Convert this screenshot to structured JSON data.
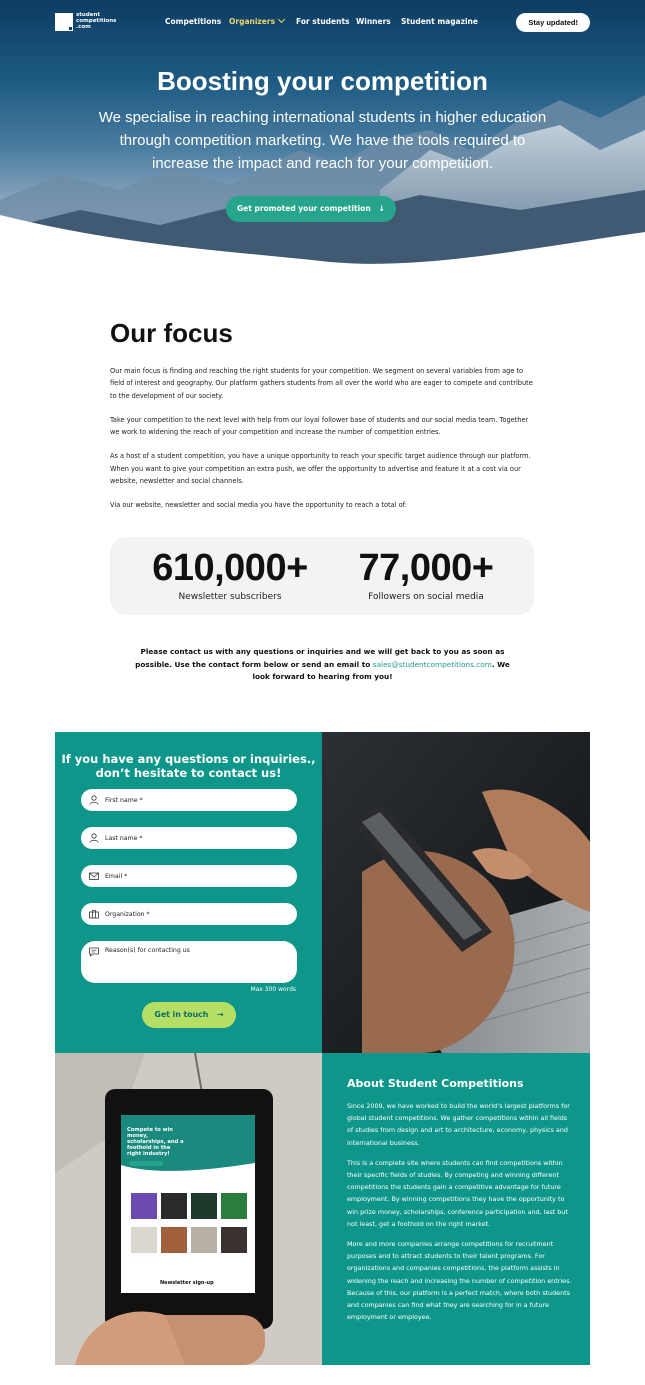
{
  "nav": {
    "logo_text": "student\ncompetitions\n.com",
    "items": [
      "Competitions",
      "Organizers",
      "For students",
      "Winners",
      "Student magazine"
    ],
    "cta": "Stay updated!"
  },
  "hero": {
    "title": "Boosting your competition",
    "subtitle": "We specialise in reaching international students in higher education through competition marketing. We have the tools required to increase the impact and reach for your competition.",
    "button": "Get promoted your competition",
    "button_arrow": "↓"
  },
  "focus": {
    "title": "Our focus",
    "paragraphs": [
      "Our main focus is finding and reaching the right students for your competition. We segment on several variables from age to field of interest and geography. Our platform gathers students from all over the world who are eager to compete and contribute to the development of our society.",
      "Take your competition to the next level with help from our loyal follower base of students and our social media team. Together we work to widening the reach of your competition and increase the number of competition entries.",
      "As a host of a student competition, you have a unique opportunity to reach your specific target audience through our platform. When you want to give your competition an extra push, we offer the opportunity to advertise and feature it at a cost via our website, newsletter and social channels.",
      "Via our website, newsletter and social media you have the opportunity to reach a total of:"
    ]
  },
  "stats": [
    {
      "value": "610,000+",
      "label": "Newsletter subscribers"
    },
    {
      "value": "77,000+",
      "label": "Followers on social media"
    }
  ],
  "contact_note": {
    "before": "Please contact us with any questions or inquiries and we will get back to you as soon as possible. Use the contact form below or send an email to ",
    "email": "sales@studentcompetitions.com",
    "after": ". We look forward to hearing from you!"
  },
  "form": {
    "title": "If you have any questions or inquiries., don’t hesitate to contact us!",
    "fields": [
      "First name *",
      "Last name *",
      "Email *",
      "Organization *",
      "Reason(s) for contacting us"
    ],
    "max_words": "Max 300 words",
    "button": "Get in touch",
    "button_arrow": "→"
  },
  "about": {
    "title": "About Student Competitions",
    "paragraphs": [
      "Since 2009, we have worked to build the world’s largest platforms for global student competitions. We gather competitions within all fields of studies from design and art to architecture, economy, physics and international business.",
      "This is a complete site where students can find competitions within their specific fields of studies. By competing and winning different competitions the students gain a competitive advantage for future employment. By winning competitions they have the opportunity to win prize money, scholarships, conference participation and, last but not least, get a foothold on the right market.",
      "More and more companies arrange competitions for recruitment purposes and to attract students to their talent programs. For organizations and companies competitions, the platform assists in widening the reach and increasing the number of competition entries. Because of this, our platform is a perfect match, where both students and companies can find what they are searching for in a future employment or employee."
    ]
  },
  "tablet_screen": {
    "hero_text": "Compete to win money, scholarships, and a foothold in the right industry!",
    "newsletter": "Newsletter sign-up"
  },
  "colors": {
    "teal": "#0f968a",
    "green_button": "#26a58c",
    "lime_button": "#b5de65",
    "nav_active": "#e9d96a"
  }
}
